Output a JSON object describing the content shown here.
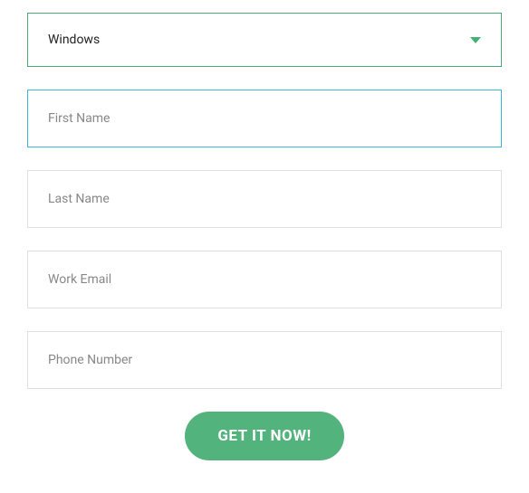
{
  "form": {
    "os_select": {
      "value": "Windows"
    },
    "first_name": {
      "placeholder": "First Name",
      "value": ""
    },
    "last_name": {
      "placeholder": "Last Name",
      "value": ""
    },
    "work_email": {
      "placeholder": "Work Email",
      "value": ""
    },
    "phone_number": {
      "placeholder": "Phone Number",
      "value": ""
    },
    "submit_label": "GET IT NOW!"
  }
}
